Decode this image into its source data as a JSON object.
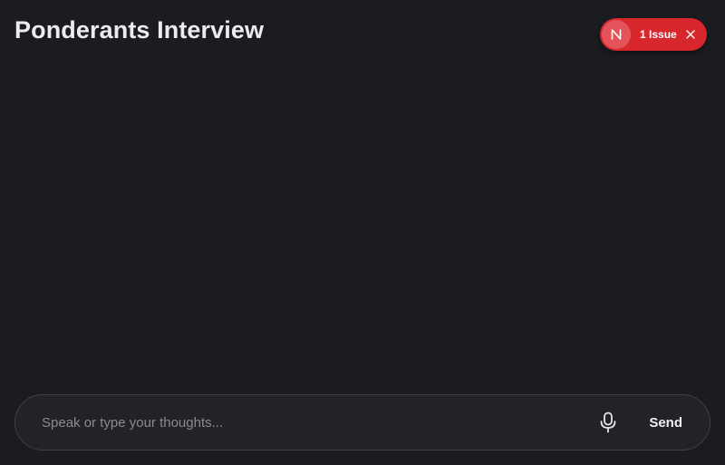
{
  "header": {
    "title": "Ponderants Interview"
  },
  "issues_indicator": {
    "badge_letter": "N",
    "label": "1 Issue",
    "badge_icon": "n-letter-icon",
    "close_icon": "close-icon",
    "color": "#d8262d"
  },
  "composer": {
    "placeholder": "Speak or type your thoughts...",
    "value": "",
    "mic_icon": "microphone-icon",
    "send_label": "Send"
  }
}
